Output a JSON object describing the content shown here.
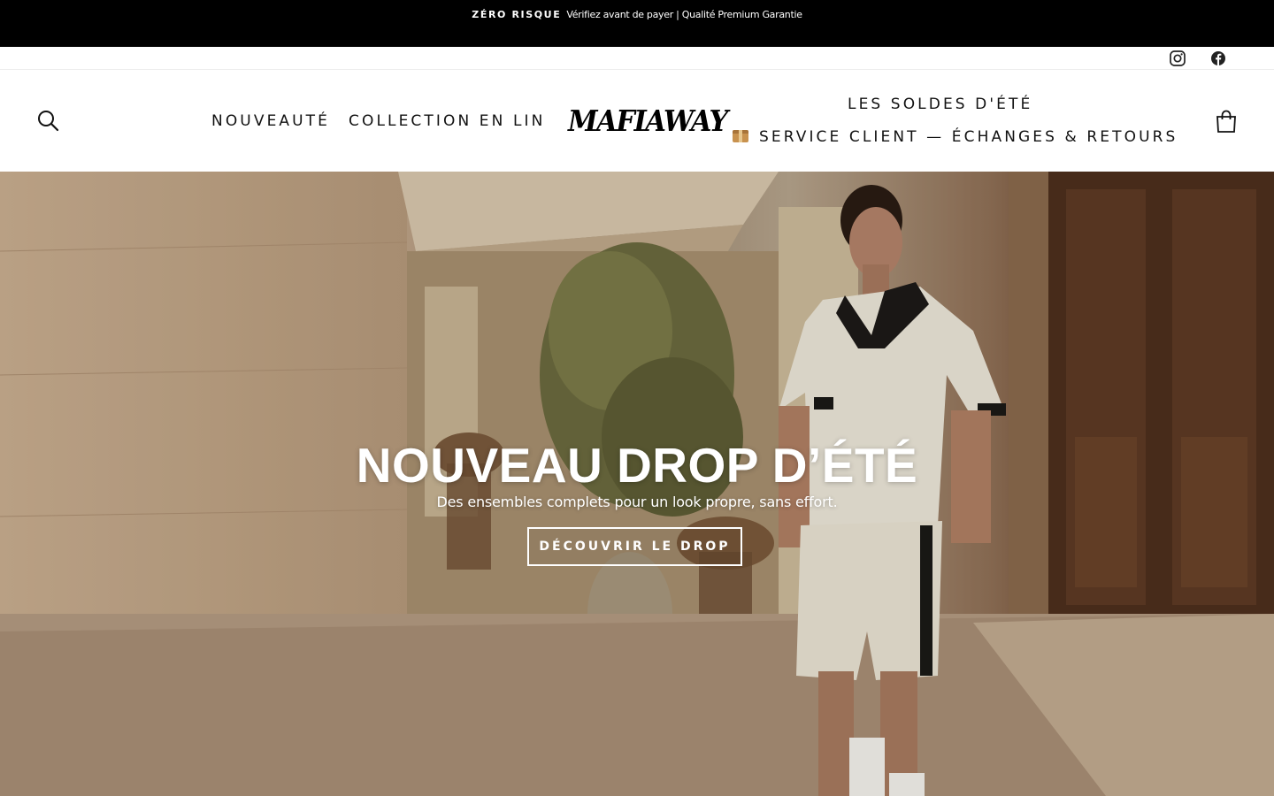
{
  "announcement": {
    "bold": "ZÉRO RISQUE",
    "text": "Vérifiez avant de payer | Qualité Premium Garantie"
  },
  "social": {
    "instagram_icon": "instagram-icon",
    "facebook_icon": "facebook-icon"
  },
  "header": {
    "logo": "MAFIAWAY",
    "search_icon": "search-icon",
    "cart_icon": "bag-icon",
    "nav": {
      "new": "NOUVEAUTÉ",
      "linen": "COLLECTION EN LIN",
      "summer_sale": "LES SOLDES D'ÉTÉ",
      "service": "SERVICE CLIENT — ÉCHANGES & RETOURS",
      "service_icon": "package-emoji-icon"
    }
  },
  "hero": {
    "title": "NOUVEAU DROP D’ÉTÉ",
    "subtitle": "Des ensembles complets pour un look propre, sans effort.",
    "cta": "DÉCOUVRIR LE DROP",
    "image_description_icon": "hero-photo"
  },
  "colors": {
    "announcement_bg": "#000000",
    "text": "#111111",
    "hero_text": "#ffffff"
  }
}
